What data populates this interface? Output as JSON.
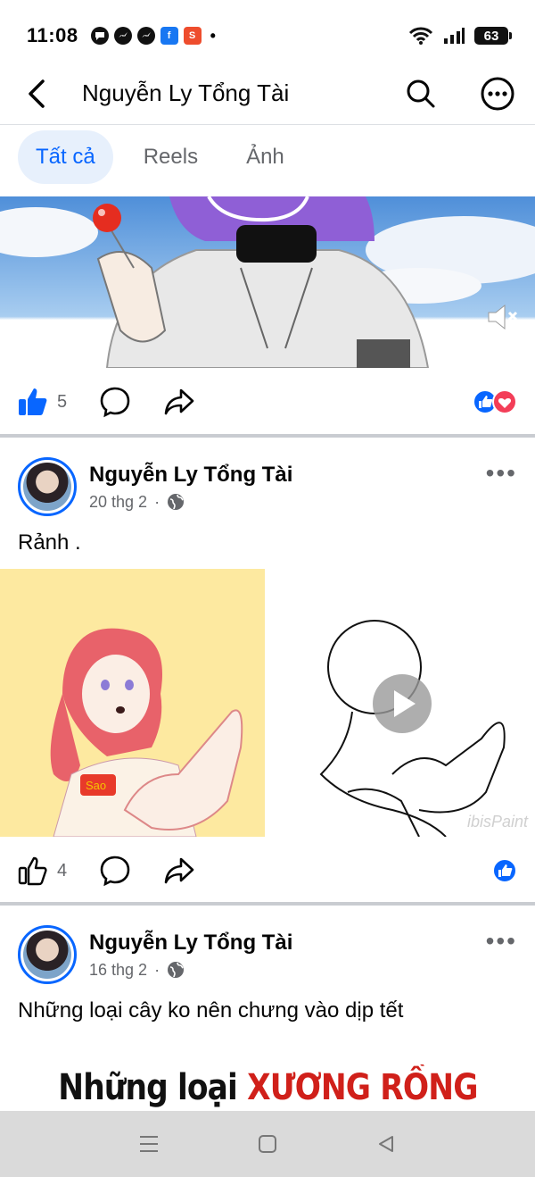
{
  "status": {
    "time": "11:08",
    "battery": "63",
    "notifications": [
      "chat-icon",
      "messenger-icon",
      "messenger-icon",
      "facebook-icon",
      "shopee-icon"
    ],
    "more_dot": "•"
  },
  "header": {
    "title": "Nguyễn Ly Tổng Tài"
  },
  "tabs": [
    {
      "label": "Tất cả",
      "active": true
    },
    {
      "label": "Reels",
      "active": false
    },
    {
      "label": "Ảnh",
      "active": false
    }
  ],
  "post1": {
    "like_count": "5",
    "reactions": [
      "like",
      "love"
    ]
  },
  "post2": {
    "author": "Nguyễn Ly Tổng Tài",
    "date": "20 thg 2",
    "separator": "·",
    "text": "Rảnh .",
    "like_count": "4",
    "watermark": "ibisPaint",
    "reactions": [
      "like"
    ]
  },
  "post3": {
    "author": "Nguyễn Ly Tổng Tài",
    "date": "16 thg 2",
    "separator": "·",
    "text": "Những loại cây ko nên chưng vào dịp tết",
    "image_text_black": "Những loại",
    "image_text_red": "XƯƠNG RỒNG"
  },
  "colors": {
    "accent": "#0866ff",
    "love": "#f33e58",
    "secondary_text": "#65676b",
    "card_yellow": "#fde9a0"
  }
}
